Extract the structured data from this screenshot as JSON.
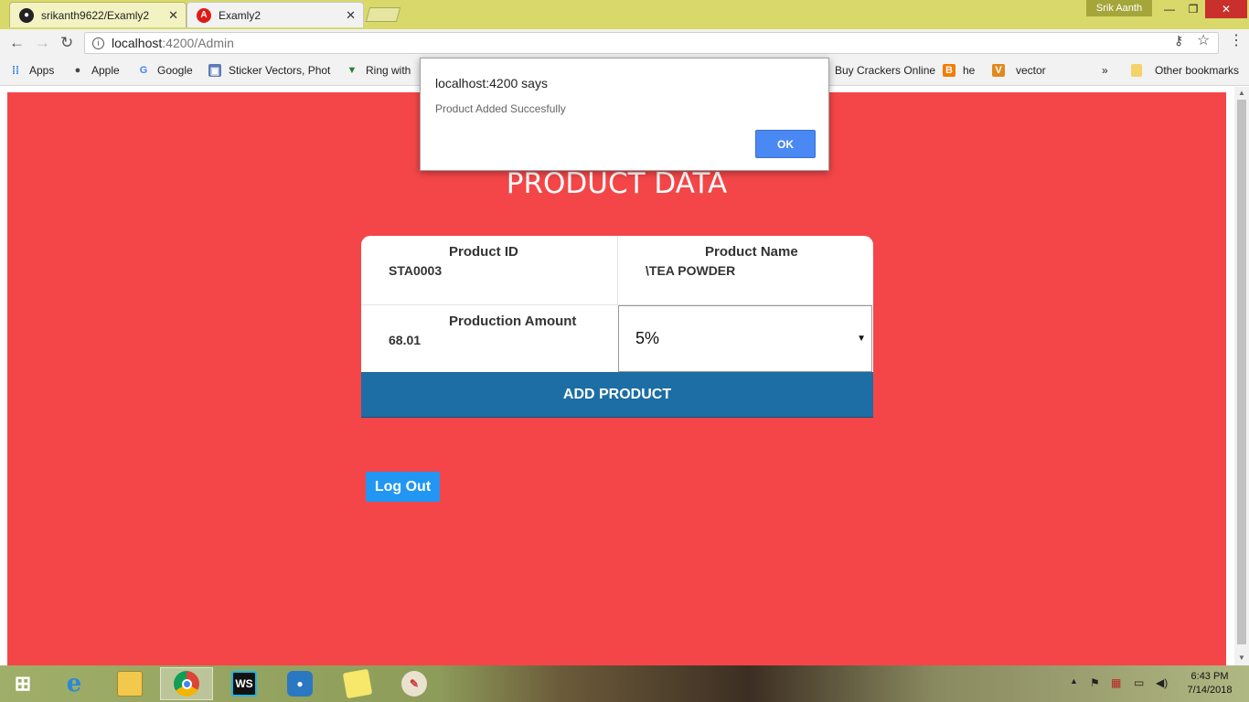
{
  "browser": {
    "tabs": [
      {
        "title": "srikanth9622/Examly2",
        "active": false,
        "icon": "github-icon"
      },
      {
        "title": "Examly2",
        "active": true,
        "icon": "angular-icon"
      }
    ],
    "profile_name": "Srik Aanth",
    "url": {
      "host": "localhost",
      "rest": ":4200/Admin"
    },
    "bookmarks": [
      {
        "label": "Apps",
        "icon": "apps-grid-icon"
      },
      {
        "label": "Apple",
        "icon": "apple-icon"
      },
      {
        "label": "Google",
        "icon": "google-icon"
      },
      {
        "label": "Sticker Vectors, Phot",
        "icon": "image-icon"
      },
      {
        "label": "Ring with",
        "icon": "ring-icon"
      },
      {
        "label": "Buy Crackers Online",
        "icon": "bookmark-icon"
      },
      {
        "label": "he",
        "icon": "blogger-icon"
      },
      {
        "label": "vector",
        "icon": "v-icon"
      }
    ],
    "bookmarks_overflow": "»",
    "other_bookmarks": "Other bookmarks"
  },
  "page": {
    "title": "PRODUCT DATA",
    "product_id": {
      "label": "Product ID",
      "value": "STA0003"
    },
    "product_name": {
      "label": "Product Name",
      "value": "\\TEA POWDER"
    },
    "production_amount": {
      "label": "Production Amount",
      "value": "68.01"
    },
    "tax_select": {
      "value": "5%"
    },
    "add_button": "ADD PRODUCT",
    "logout_button": "Log Out",
    "background_color": "#f44648"
  },
  "dialog": {
    "title": "localhost:4200 says",
    "message": "Product Added Succesfully",
    "ok_label": "OK"
  },
  "taskbar": {
    "apps": [
      "start",
      "internet-explorer",
      "file-explorer",
      "chrome",
      "webstorm",
      "camera",
      "sticky-notes",
      "paint"
    ],
    "time": "6:43 PM",
    "date": "7/14/2018"
  }
}
